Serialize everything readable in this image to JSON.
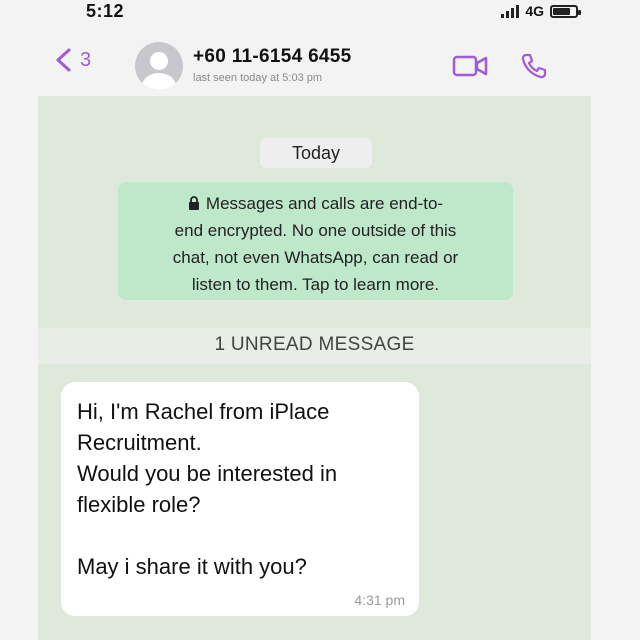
{
  "status_bar": {
    "time": "5:12",
    "network": "4G"
  },
  "header": {
    "back_count": "3",
    "contact_name": "+60 11-6154 6455",
    "contact_status": "last seen today at 5:03 pm"
  },
  "chat": {
    "date_label": "Today",
    "encryption_lines": [
      "Messages and calls are end-to-",
      "end encrypted. No one outside of this",
      "chat, not even WhatsApp, can read or",
      "listen to them. Tap to learn more."
    ],
    "unread_label": "1 UNREAD MESSAGE",
    "message": {
      "lines": [
        "Hi, I'm Rachel from iPlace",
        "Recruitment.",
        "Would you be interested in",
        "flexible role?",
        "",
        "May i share it with you?"
      ],
      "time": "4:31 pm"
    }
  },
  "colors": {
    "accent": "#a05bd6",
    "chat_bg": "#dfe9db",
    "encryption_bg": "#bfe7c9"
  },
  "icons": [
    "back-icon",
    "avatar-icon",
    "video-call-icon",
    "phone-icon",
    "lock-icon",
    "signal-icon",
    "battery-icon"
  ]
}
